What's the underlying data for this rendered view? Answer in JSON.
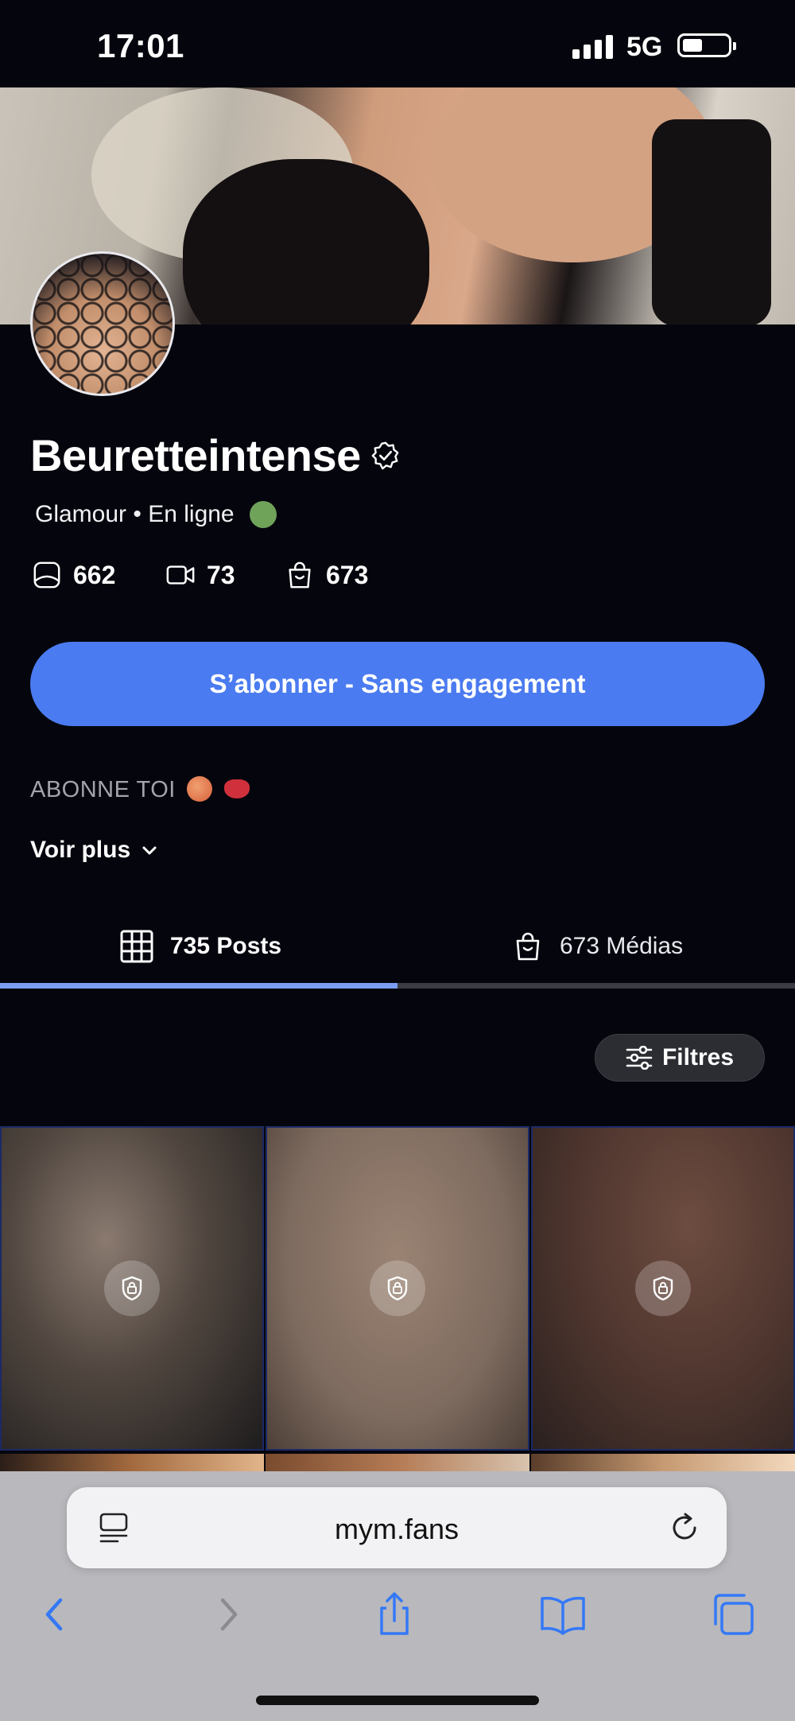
{
  "status_bar": {
    "time": "17:01",
    "network": "5G"
  },
  "profile": {
    "name": "Beuretteintense",
    "meta": "Glamour • En ligne",
    "stats": [
      {
        "icon": "photo-icon",
        "count": "662"
      },
      {
        "icon": "video-icon",
        "count": "73"
      },
      {
        "icon": "bag-icon",
        "count": "673"
      }
    ],
    "subscribe_label": "S’abonner - Sans engagement",
    "bio": "ABONNE TOI",
    "see_more_label": "Voir plus"
  },
  "tabs": [
    {
      "label": "735 Posts",
      "icon": "grid-icon",
      "active": true
    },
    {
      "label": "673 Médias",
      "icon": "bag-icon",
      "active": false
    }
  ],
  "filters_label": "Filtres",
  "browser": {
    "url": "mym.fans"
  },
  "colors": {
    "accent": "#4b7bf0",
    "online": "#6fa35a",
    "background": "#05060d",
    "tab_indicator": "#7b9cf2"
  }
}
